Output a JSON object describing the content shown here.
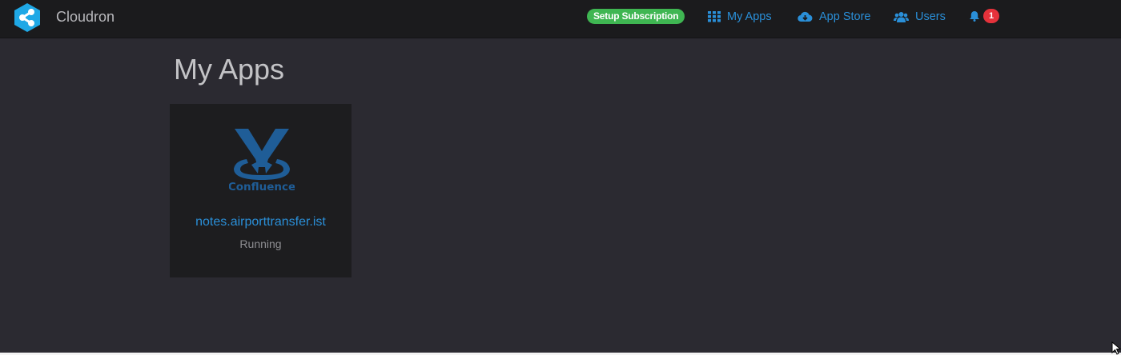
{
  "brand": {
    "name": "Cloudron",
    "logo_icon": "cloudron-logo-icon",
    "accent": "#1fa8e6"
  },
  "nav": {
    "subscription_label": "Setup Subscription",
    "items": [
      {
        "label": "My Apps",
        "icon": "grid-icon"
      },
      {
        "label": "App Store",
        "icon": "cloud-download-icon"
      },
      {
        "label": "Users",
        "icon": "users-icon"
      }
    ],
    "notifications": {
      "icon": "bell-icon",
      "count": "1"
    }
  },
  "main": {
    "title": "My Apps",
    "apps": [
      {
        "domain": "notes.airporttransfer.ist",
        "status": "Running",
        "logo_text": "Confluence",
        "logo_icon": "confluence-logo-icon"
      }
    ]
  },
  "colors": {
    "link": "#2a8fd8",
    "badge_green": "#3fb652",
    "notif_red": "#e5323b",
    "bg": "#2b2a31",
    "topbar": "#1b1b1d"
  }
}
